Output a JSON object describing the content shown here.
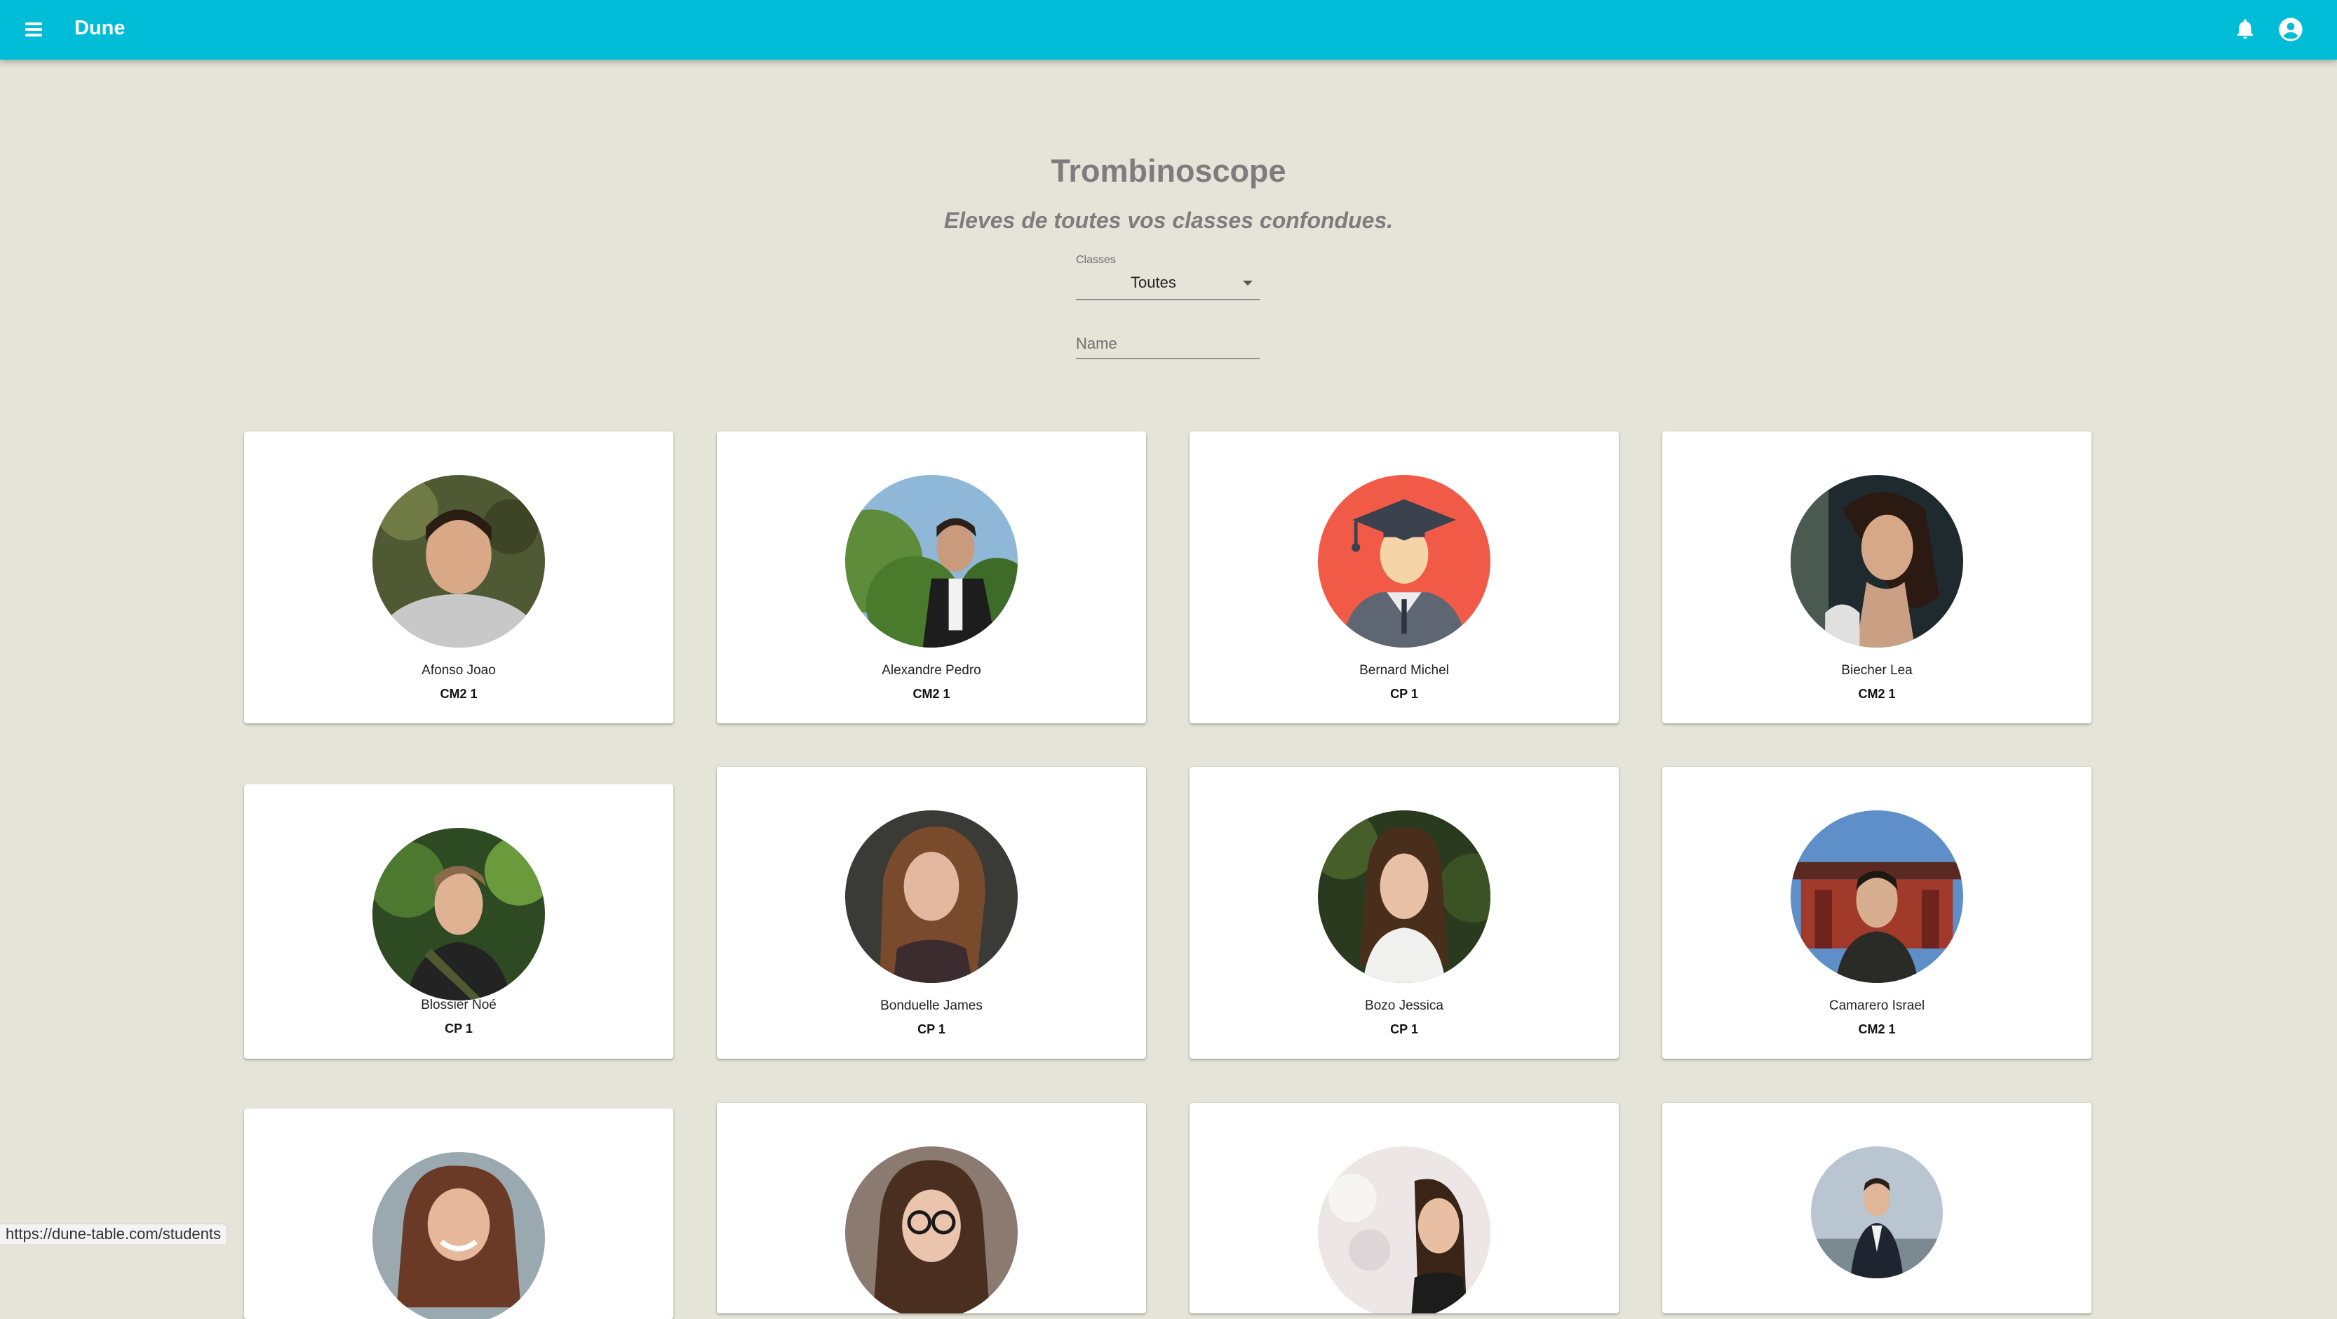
{
  "app": {
    "title": "Dune"
  },
  "header": {
    "title": "Trombinoscope",
    "subtitle": "Eleves de toutes vos classes confondues."
  },
  "filters": {
    "classes_label": "Classes",
    "classes_value": "Toutes",
    "name_placeholder": "Name"
  },
  "students": [
    {
      "name": "Afonso Joao",
      "class": "CM2 1",
      "photo": "photo-shirt-light"
    },
    {
      "name": "Alexandre Pedro",
      "class": "CM2 1",
      "photo": "photo-trees"
    },
    {
      "name": "Bernard Michel",
      "class": "CP 1",
      "photo": "graduate-avatar-icon"
    },
    {
      "name": "Biecher Lea",
      "class": "CM2 1",
      "photo": "photo-dark"
    },
    {
      "name": "Blossier Noé",
      "class": "CP 1",
      "photo": "photo-green"
    },
    {
      "name": "Bonduelle James",
      "class": "CP 1",
      "photo": "photo-warm"
    },
    {
      "name": "Bozo Jessica",
      "class": "CP 1",
      "photo": "photo-green-dark"
    },
    {
      "name": "Camarero Israel",
      "class": "CM2 1",
      "photo": "photo-temple"
    },
    {
      "name": "",
      "class": "",
      "photo": "photo-outdoor"
    },
    {
      "name": "",
      "class": "",
      "photo": "photo-glasses"
    },
    {
      "name": "",
      "class": "",
      "photo": "photo-flowers"
    },
    {
      "name": "",
      "class": "",
      "photo": "photo-suit"
    }
  ],
  "status_url": "https://dune-table.com/students",
  "colors": {
    "appbar": "#00bcd6",
    "background": "#e4e4d8",
    "graduate_bg": "#f05a47"
  }
}
